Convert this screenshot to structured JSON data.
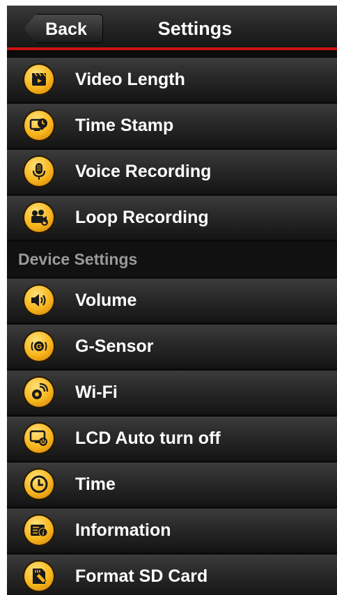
{
  "nav": {
    "back_label": "Back",
    "title": "Settings"
  },
  "video_items": [
    {
      "label": "Video Length",
      "icon": "clapperboard-icon"
    },
    {
      "label": "Time Stamp",
      "icon": "monitor-clock-icon"
    },
    {
      "label": "Voice Recording",
      "icon": "microphone-icon"
    },
    {
      "label": "Loop Recording",
      "icon": "camera-loop-icon"
    }
  ],
  "device_section": {
    "title": "Device Settings"
  },
  "device_items": [
    {
      "label": "Volume",
      "icon": "speaker-icon"
    },
    {
      "label": "G-Sensor",
      "icon": "g-sensor-icon"
    },
    {
      "label": "Wi-Fi",
      "icon": "wifi-gear-icon"
    },
    {
      "label": "LCD Auto turn off",
      "icon": "monitor-power-icon"
    },
    {
      "label": "Time",
      "icon": "clock-icon"
    },
    {
      "label": "Information",
      "icon": "info-device-icon"
    },
    {
      "label": "Format SD Card",
      "icon": "sd-card-icon"
    }
  ],
  "colors": {
    "accent_red": "#cc1212",
    "icon_orange": "#f7b51c",
    "row_text": "#ffffff",
    "section_text": "#9a9a9a"
  }
}
